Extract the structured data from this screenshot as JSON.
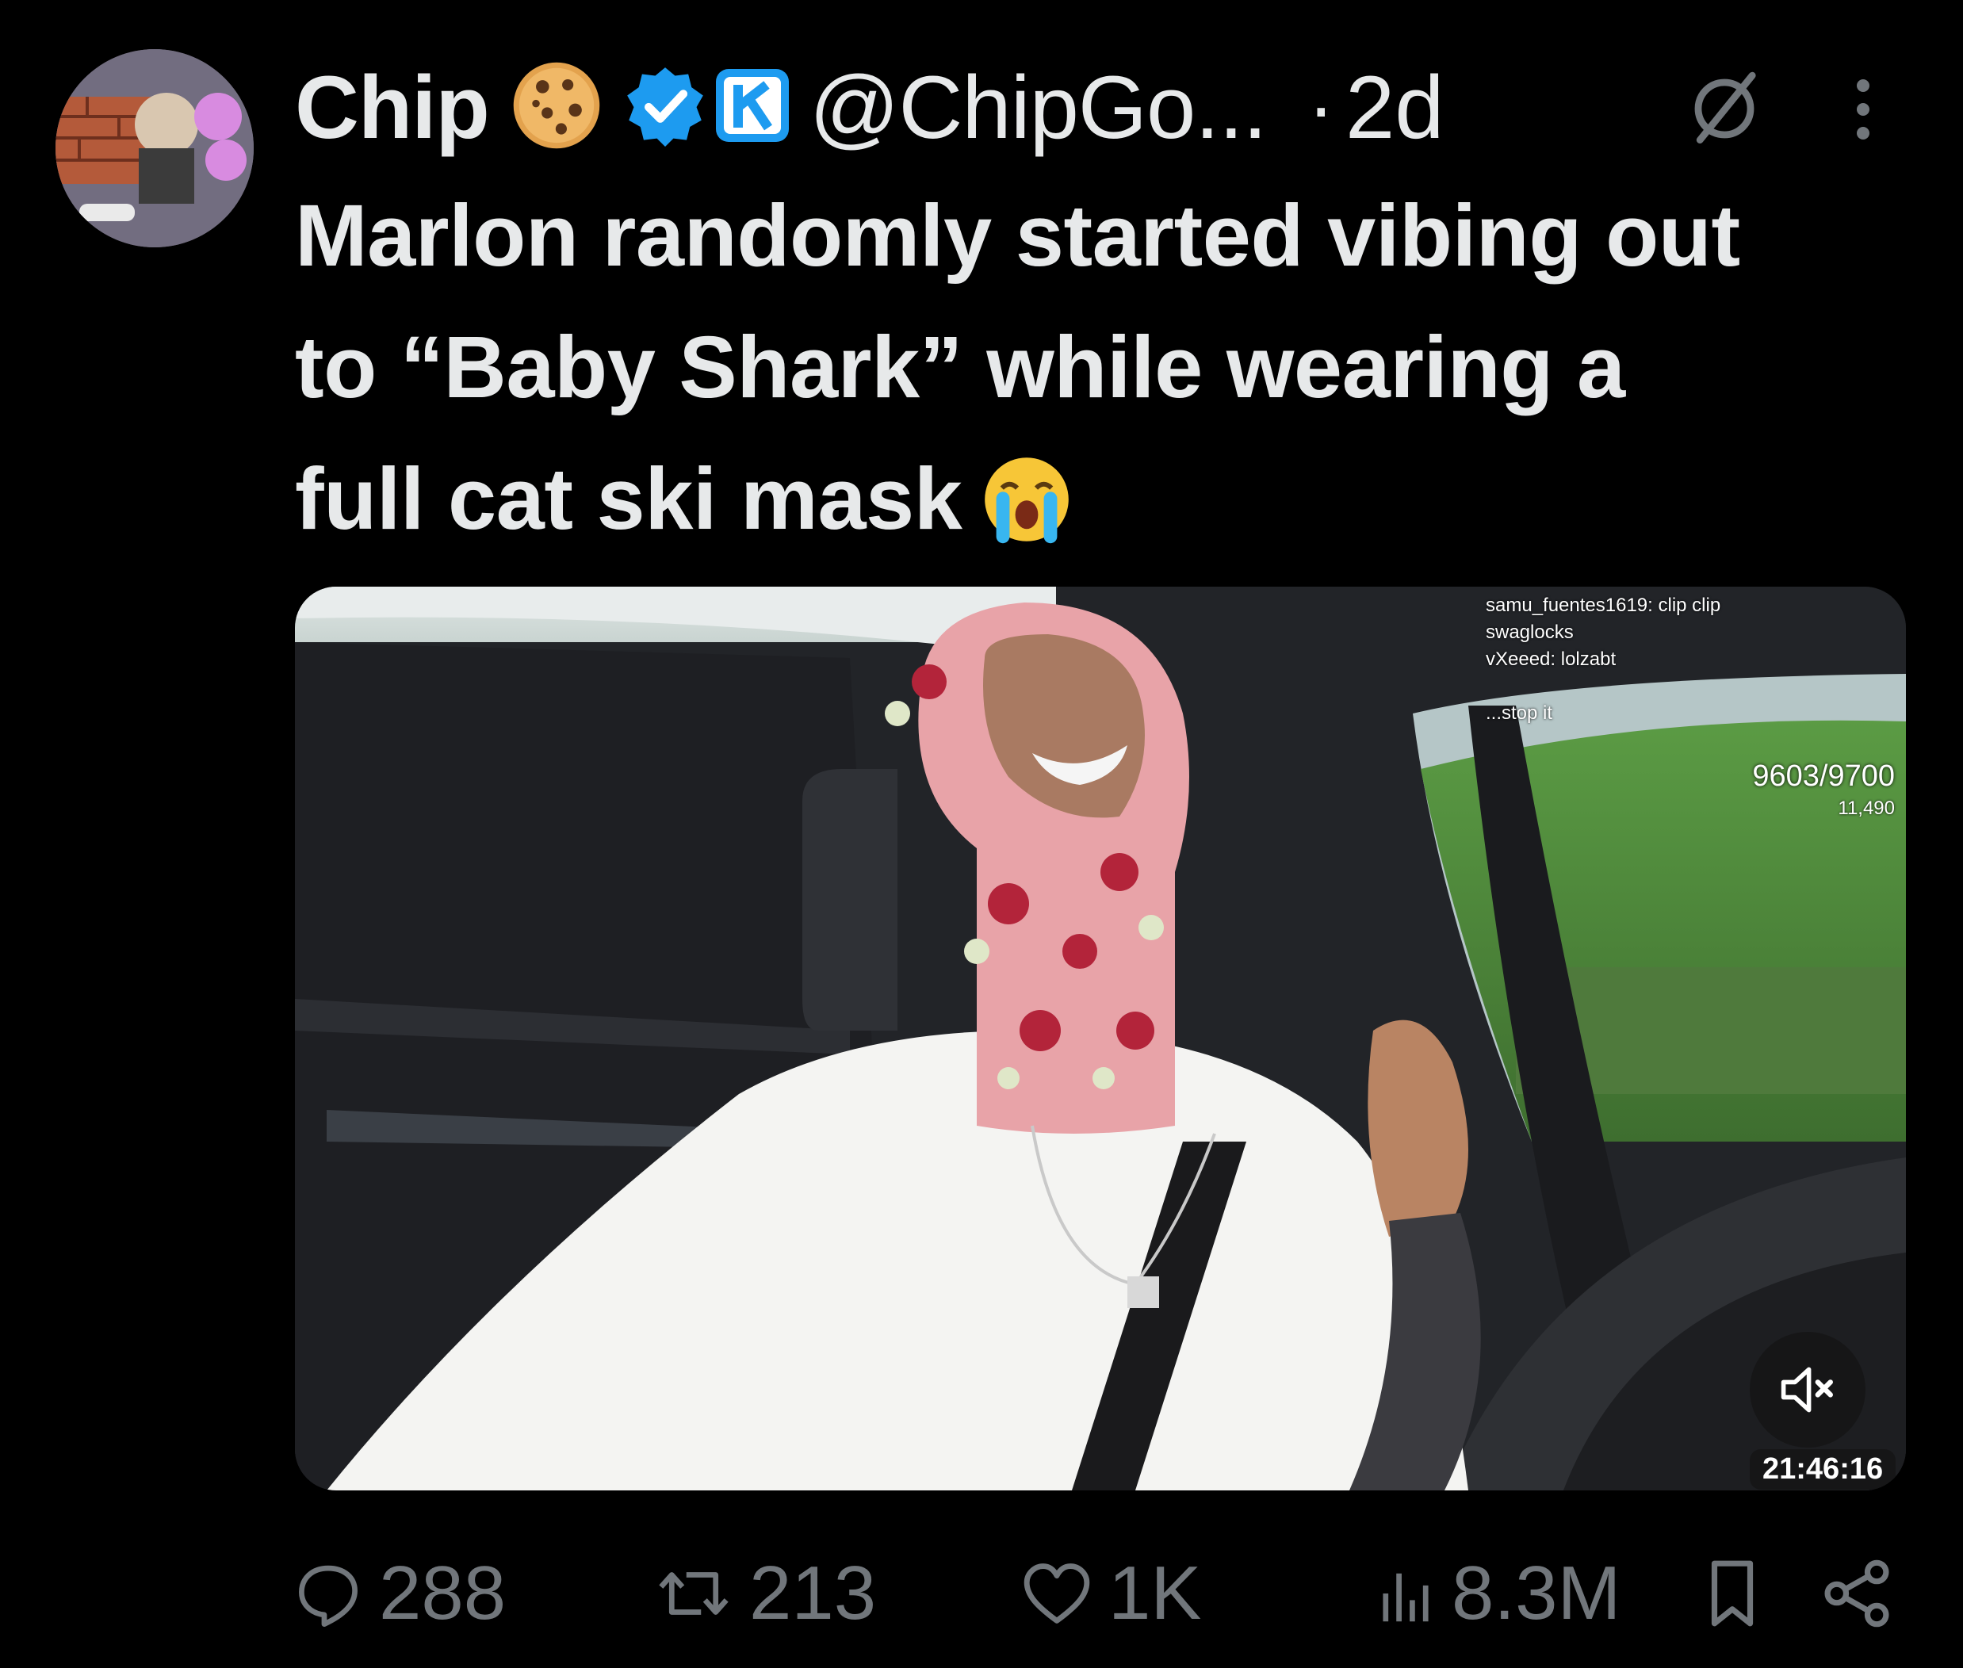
{
  "tweet": {
    "display_name": "Chip",
    "handle": "@ChipGo...",
    "separator": "·",
    "time": "2d",
    "text_lines": [
      "Marlon randomly started vibing out",
      "to “Baby Shark” while wearing a",
      "full cat ski mask"
    ],
    "emoji_name_icon": "cookie-emoji-icon",
    "emoji_text_icon": "loudly-crying-face-emoji-icon"
  },
  "media": {
    "chat": [
      "samu_fuentes1619: clip clip",
      "swaglocks",
      "vXeeed: lolzabt",
      "",
      "...stop it"
    ],
    "viewer_count": "9603/9700",
    "viewer_sub": "11,490",
    "duration": "21:46:16"
  },
  "actions": {
    "replies": "288",
    "reposts": "213",
    "likes": "1K",
    "views": "8.3M"
  },
  "colors": {
    "background": "#000000",
    "text": "#e7e9ea",
    "muted": "#71767b",
    "verified": "#1d9bf0"
  }
}
